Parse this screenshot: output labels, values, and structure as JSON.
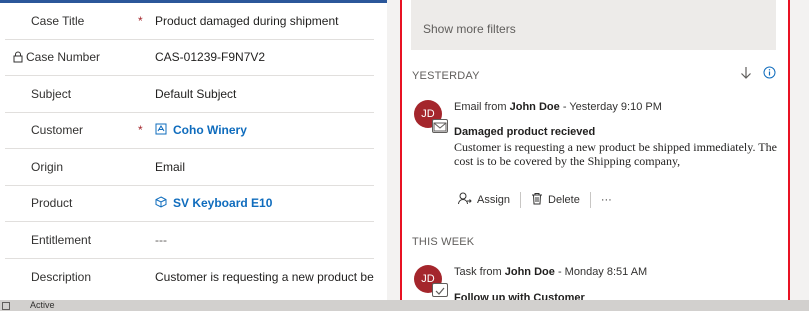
{
  "form": {
    "fields": [
      {
        "label": "Case Title",
        "required": "*",
        "value": "Product damaged during shipment"
      },
      {
        "label": "Case Number",
        "value": "CAS-01239-F9N7V2"
      },
      {
        "label": "Subject",
        "value": "Default Subject"
      },
      {
        "label": "Customer",
        "required": "*",
        "value": "Coho Winery",
        "icon": "account-icon"
      },
      {
        "label": "Origin",
        "value": "Email"
      },
      {
        "label": "Product",
        "value": "SV Keyboard E10",
        "icon": "product-cube-icon"
      },
      {
        "label": "Entitlement",
        "value": "---"
      },
      {
        "label": "Description",
        "value": "Customer is requesting a new product be"
      }
    ]
  },
  "timeline": {
    "filters_label": "Show more filters",
    "groups": [
      {
        "heading": "YESTERDAY"
      },
      {
        "heading": "THIS WEEK"
      }
    ],
    "items": [
      {
        "avatar": "JD",
        "type_prefix": "Email from",
        "author": "John Doe",
        "dash": "-",
        "time": "Yesterday 9:10 PM",
        "subject": "Damaged product recieved",
        "body": "Customer is requesting a new product be shipped immediately. The cost is to be covered by the Shipping company,",
        "actions": {
          "assign": "Assign",
          "delete": "Delete",
          "more": "···"
        }
      },
      {
        "avatar": "JD",
        "type_prefix": "Task from",
        "author": "John Doe",
        "dash": "-",
        "time": "Monday 8:51 AM",
        "subject": "Follow up with Customer"
      }
    ]
  },
  "bottom": {
    "label": "Active"
  },
  "colors": {
    "accent": "#0f6cbd",
    "avatar": "#a4262c",
    "highlight_border": "#e81123",
    "required": "#a4262c"
  }
}
